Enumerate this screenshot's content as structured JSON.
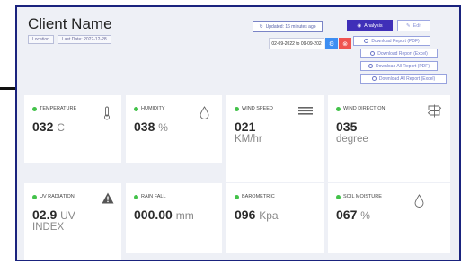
{
  "header": {
    "title": "Client Name",
    "location_chip": "Location",
    "last_date_chip": "Last Date: 2022-12-28",
    "updated_text": "Updated: 16 minutes ago",
    "analysis_label": "Analysis",
    "edit_label": "Edit",
    "date_range": "02-09-2022 to 09-09-202"
  },
  "downloads": [
    {
      "label": "Download Report (PDF)"
    },
    {
      "label": "Download Report (Excel)"
    },
    {
      "label": "Download All Report (PDF)"
    },
    {
      "label": "Download All Report (Excel)"
    }
  ],
  "cards": [
    {
      "label": "TEMPERATURE",
      "value": "032",
      "unit": "C",
      "icon": "thermometer-icon"
    },
    {
      "label": "HUMIDITY",
      "value": "038",
      "unit": "%",
      "icon": "droplet-icon"
    },
    {
      "label": "WIND SPEED",
      "value": "021",
      "unit": "KM/hr",
      "icon": "wind-lines-icon"
    },
    {
      "label": "WIND DIRECTION",
      "value": "035",
      "unit": "degree",
      "icon": "signpost-icon"
    },
    {
      "label": "UV RADIATION",
      "value": "02.9",
      "unit": "UV",
      "unit2": "INDEX",
      "icon": "warning-icon"
    },
    {
      "label": "RAIN FALL",
      "value": "000.00",
      "unit": "mm",
      "icon": ""
    },
    {
      "label": "BAROMETRIC",
      "value": "096",
      "unit": "Kpa",
      "icon": ""
    },
    {
      "label": "SOIL MOISTURE",
      "value": "067",
      "unit": "%",
      "icon": "droplet-icon"
    }
  ],
  "colors": {
    "frame_border": "#1a237e",
    "analysis_button": "#3f2fb8",
    "status_dot": "#43c24a",
    "go_button": "#3d8ef2",
    "clear_button": "#ef5350"
  }
}
